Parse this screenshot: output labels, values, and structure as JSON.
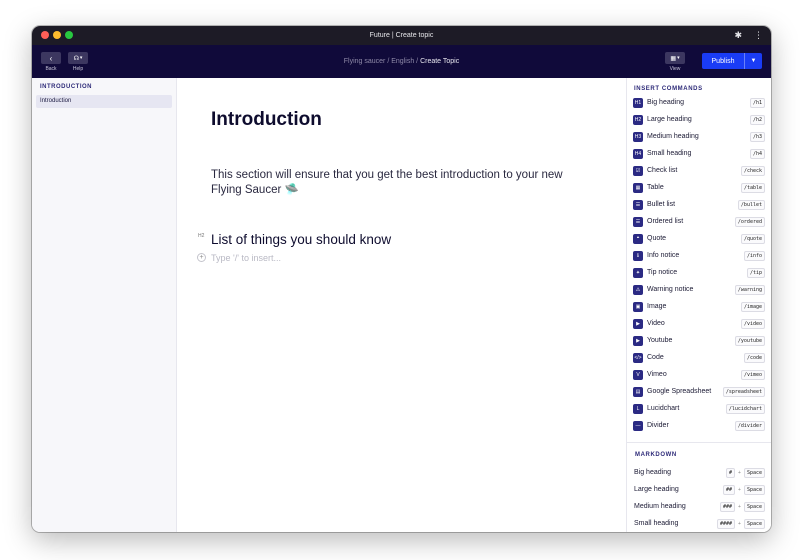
{
  "window": {
    "title": "Future | Create topic"
  },
  "toolbar": {
    "back_label": "Back",
    "help_label": "Help",
    "view_label": "View",
    "publish_label": "Publish",
    "breadcrumb": {
      "part1": "Flying saucer",
      "sep1": " / ",
      "part2": "English",
      "sep2": " / ",
      "current": "Create Topic"
    }
  },
  "sidebar": {
    "heading": "INTRODUCTION",
    "items": [
      {
        "label": "Introduction"
      }
    ]
  },
  "editor": {
    "title": "Introduction",
    "paragraph": "This section will ensure that you get the best introduction to your new Flying Saucer 🛸",
    "h2_tag": "H2",
    "h2": "List of things you should know",
    "placeholder": "Type '/' to insert..."
  },
  "insert_panel": {
    "heading": "INSERT COMMANDS",
    "commands": [
      {
        "label": "Big heading",
        "shortcut": "/h1",
        "icon": "H1"
      },
      {
        "label": "Large heading",
        "shortcut": "/h2",
        "icon": "H2"
      },
      {
        "label": "Medium heading",
        "shortcut": "/h3",
        "icon": "H3"
      },
      {
        "label": "Small heading",
        "shortcut": "/h4",
        "icon": "H4"
      },
      {
        "label": "Check list",
        "shortcut": "/check",
        "icon": "☑"
      },
      {
        "label": "Table",
        "shortcut": "/table",
        "icon": "▦"
      },
      {
        "label": "Bullet list",
        "shortcut": "/bullet",
        "icon": "☰"
      },
      {
        "label": "Ordered list",
        "shortcut": "/ordered",
        "icon": "☰"
      },
      {
        "label": "Quote",
        "shortcut": "/quote",
        "icon": "❝"
      },
      {
        "label": "Info notice",
        "shortcut": "/info",
        "icon": "ℹ"
      },
      {
        "label": "Tip notice",
        "shortcut": "/tip",
        "icon": "✦"
      },
      {
        "label": "Warning notice",
        "shortcut": "/warning",
        "icon": "⚠"
      },
      {
        "label": "Image",
        "shortcut": "/image",
        "icon": "▣"
      },
      {
        "label": "Video",
        "shortcut": "/video",
        "icon": "▶"
      },
      {
        "label": "Youtube",
        "shortcut": "/youtube",
        "icon": "▶"
      },
      {
        "label": "Code",
        "shortcut": "/code",
        "icon": "</>"
      },
      {
        "label": "Vimeo",
        "shortcut": "/vimeo",
        "icon": "V"
      },
      {
        "label": "Google Spreadsheet",
        "shortcut": "/spreadsheet",
        "icon": "▤"
      },
      {
        "label": "Lucidchart",
        "shortcut": "/lucidchart",
        "icon": "L"
      },
      {
        "label": "Divider",
        "shortcut": "/divider",
        "icon": "—"
      }
    ]
  },
  "markdown_panel": {
    "heading": "MARKDOWN",
    "plus": "+",
    "items": [
      {
        "label": "Big heading",
        "key": "#",
        "key2": "Space"
      },
      {
        "label": "Large heading",
        "key": "##",
        "key2": "Space"
      },
      {
        "label": "Medium heading",
        "key": "###",
        "key2": "Space"
      },
      {
        "label": "Small heading",
        "key": "####",
        "key2": "Space"
      }
    ]
  }
}
